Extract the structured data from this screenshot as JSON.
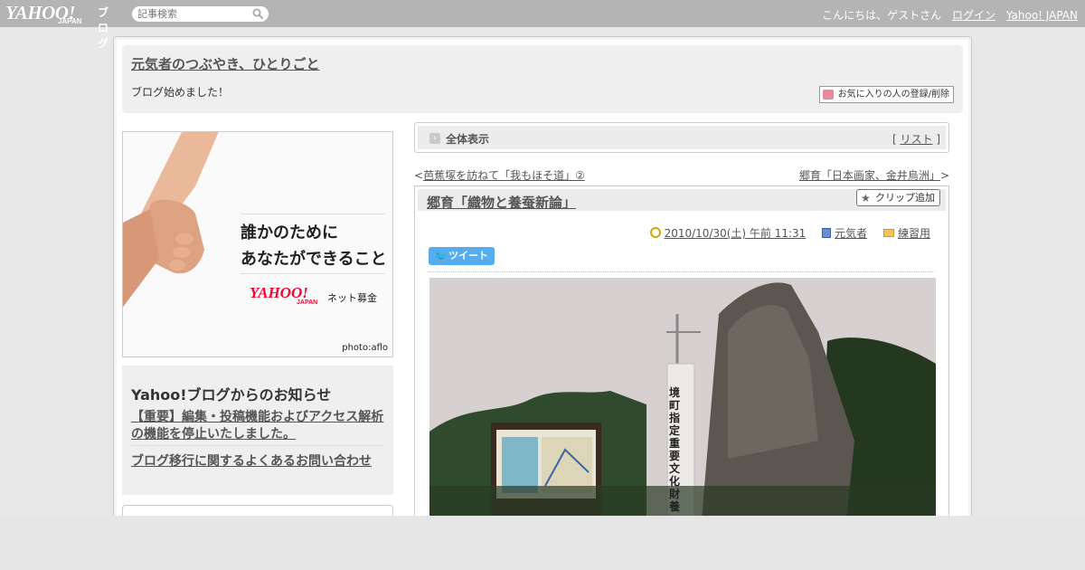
{
  "topbar": {
    "logo_yahoo": "YAHOO!",
    "logo_japan": "JAPAN",
    "logo_blog": "ブログ",
    "search_placeholder": "記事検索",
    "greeting": "こんにちは、ゲストさん",
    "login": "ログイン",
    "yahoo_japan": "Yahoo! JAPAN"
  },
  "header": {
    "blog_title": "元気者のつぶやき、ひとりごと",
    "description": "ブログ始めました！",
    "favorite_button": "お気に入りの人の登録/削除"
  },
  "ad": {
    "line1": "誰かのために",
    "line2": "あなたができること",
    "logo": "YAHOO!",
    "logo_japan": "JAPAN",
    "service": "ネット募金",
    "credit": "photo:aflo"
  },
  "notice": {
    "title": "Yahoo!ブログからのお知らせ",
    "items": [
      "【重要】編集・投稿機能およびアクセス解析の機能を停止いたしました。",
      "ブログ移行に関するよくあるお問い合わせ"
    ]
  },
  "viewbar": {
    "label": "全体表示",
    "list_link": "リスト"
  },
  "nav": {
    "prev": "芭蕉塚を訪ねて「我もほそ道」②",
    "next": "郷育「日本画家、金井烏洲」"
  },
  "article": {
    "title": "郷育「織物と養蚕新論」",
    "clip_button": "クリップ追加",
    "datetime": "2010/10/30(土) 午前 11:31",
    "author": "元気者",
    "category": "練習用",
    "tweet_button": "ツイート",
    "photo_label": "境町指定重要文化財 養"
  }
}
